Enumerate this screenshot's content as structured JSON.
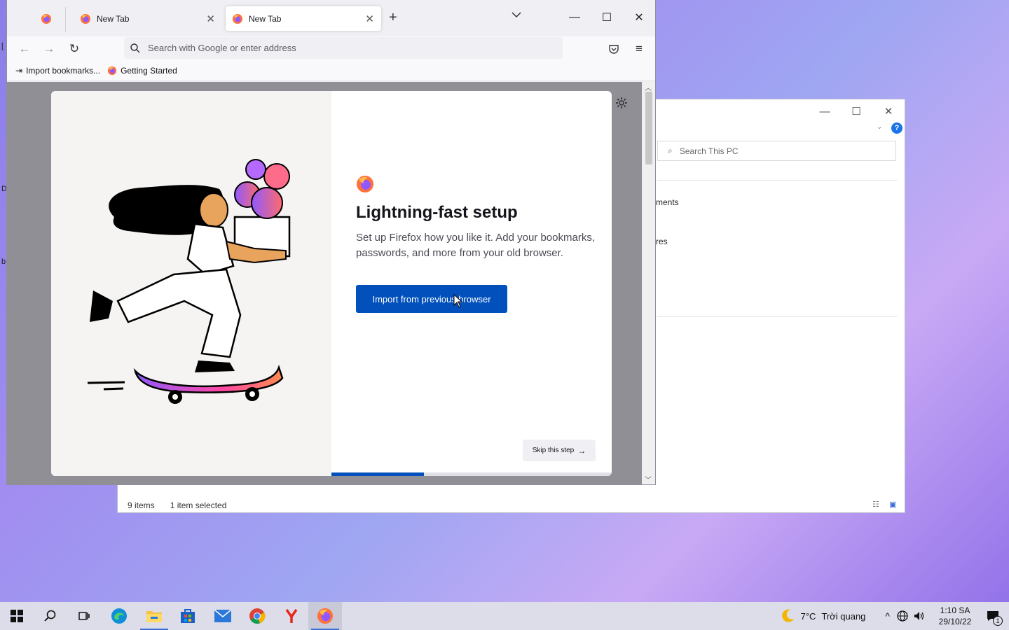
{
  "desktop": {
    "edge_labels": [
      "[",
      "D",
      "b"
    ]
  },
  "explorer": {
    "search_placeholder": "Search This PC",
    "items": [
      "ments",
      "res"
    ],
    "status": {
      "count": "9 items",
      "selected": "1 item selected"
    },
    "help_label": "?"
  },
  "firefox": {
    "tabs": [
      {
        "label": "New Tab"
      },
      {
        "label": "New Tab",
        "selected": true
      }
    ],
    "new_tab_label": "+",
    "url_placeholder": "Search with Google or enter address",
    "bookmarks": [
      {
        "label": "Import bookmarks...",
        "icon": "import-icon"
      },
      {
        "label": "Getting Started",
        "icon": "firefox-icon"
      }
    ],
    "modal": {
      "title": "Lightning-fast setup",
      "subtitle": "Set up Firefox how you like it. Add your bookmarks, passwords, and more from your old browser.",
      "primary_button": "Import from previous browser",
      "skip_button": "Skip this step",
      "progress_fraction": 0.33
    }
  },
  "taskbar": {
    "weather": {
      "temp": "7°C",
      "text": "Trời quang"
    },
    "clock": {
      "time": "1:10 SA",
      "date": "29/10/22"
    },
    "notification_count": "1"
  },
  "colors": {
    "accent": "#0250bb",
    "taskbar": "#dcdde8"
  }
}
